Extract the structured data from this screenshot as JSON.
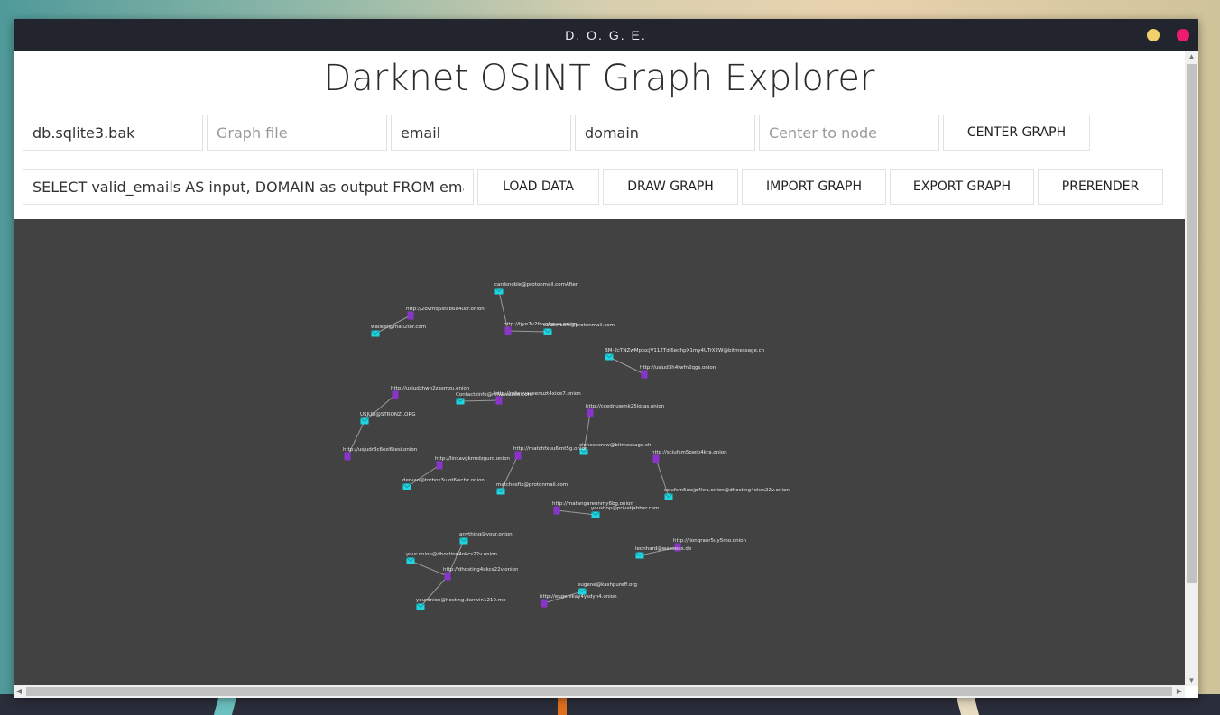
{
  "window": {
    "title": "D. O. G. E.",
    "controls": [
      "minimize",
      "close"
    ],
    "colors": {
      "titlebar": "#23252e",
      "minimize": "#f2d06b",
      "close": "#ef1b6f"
    }
  },
  "app": {
    "title": "Darknet OSINT Graph Explorer"
  },
  "toolbar_row1": {
    "db_file": {
      "value": "db.sqlite3.bak",
      "placeholder": ""
    },
    "graph_file": {
      "value": "",
      "placeholder": "Graph file"
    },
    "input_column": {
      "value": "email",
      "placeholder": ""
    },
    "output_column": {
      "value": "domain",
      "placeholder": ""
    },
    "center_node": {
      "value": "",
      "placeholder": "Center to node"
    },
    "center_graph_label": "CENTER GRAPH"
  },
  "toolbar_row2": {
    "query": {
      "value": "SELECT valid_emails AS input, DOMAIN as output FROM emails",
      "placeholder": ""
    },
    "load_data_label": "LOAD DATA",
    "draw_graph_label": "DRAW GRAPH",
    "import_graph_label": "IMPORT GRAPH",
    "export_graph_label": "EXPORT GRAPH",
    "prerender_label": "PRERENDER"
  },
  "graph": {
    "background": "#424242",
    "node_colors": {
      "email": "#1fd6e0",
      "domain": "#8a35c9"
    },
    "edge_color": "#9a9a9a",
    "nodes": [
      {
        "id": "n1",
        "type": "email",
        "label": "cardsnoble@protonmail.comAfter"
      },
      {
        "id": "n2",
        "type": "domain",
        "label": "http://tjye7v2fnxqfgsaa.onion"
      },
      {
        "id": "n3",
        "type": "email",
        "label": "cardsnoble@protonmail.com"
      },
      {
        "id": "n4",
        "type": "domain",
        "label": "http://2ovmq6sfab6u4ucr.onion"
      },
      {
        "id": "n5",
        "type": "email",
        "label": "wallker@mail2tor.com"
      },
      {
        "id": "n6",
        "type": "email",
        "label": "BM-2cTNZwMptscjV112Tdi6edhpX1my4UTrX2W@bitmessage.ch"
      },
      {
        "id": "n7",
        "type": "domain",
        "label": "http://usjud3h4fwfn2qgs.onion"
      },
      {
        "id": "n8",
        "type": "domain",
        "label": "http://usjudzhwh2zasmzu.onion"
      },
      {
        "id": "n9",
        "type": "email",
        "label": "USJUD@STRONZI.ORG"
      },
      {
        "id": "n10",
        "type": "domain",
        "label": "http://usjudr3c6ezi6tesi.onion"
      },
      {
        "id": "n11",
        "type": "email",
        "label": "Contactsinfo@mfwavazee.com"
      },
      {
        "id": "n12",
        "type": "domain",
        "label": "http://mfwavazeenuzt4xioe7.onion"
      },
      {
        "id": "n13",
        "type": "domain",
        "label": "http://ccednuwmk25iqtas.onion"
      },
      {
        "id": "n14",
        "type": "email",
        "label": "clonecccrew@bitmessage.ch"
      },
      {
        "id": "n15",
        "type": "domain",
        "label": "http://matchfxuu6znt5g.onion"
      },
      {
        "id": "n16",
        "type": "email",
        "label": "matchesfix@protonmail.com"
      },
      {
        "id": "n17",
        "type": "domain",
        "label": "http://linkavgkrmdzguro.onion"
      },
      {
        "id": "n18",
        "type": "email",
        "label": "dervan@torbox3uiot6wchz.onion"
      },
      {
        "id": "n19",
        "type": "domain",
        "label": "http://scjufsm5owjp4kra.onion"
      },
      {
        "id": "n20",
        "type": "email",
        "label": "scjufsm5owjp4kra.onion@dhosting4okcs22v.onion"
      },
      {
        "id": "n21",
        "type": "domain",
        "label": "http://matangareonmy6bg.onion"
      },
      {
        "id": "n22",
        "type": "email",
        "label": "youshop@privatjabber.com"
      },
      {
        "id": "n23",
        "type": "email",
        "label": "anything@your.onion"
      },
      {
        "id": "n24",
        "type": "email",
        "label": "your.onion@dhosting4okcs22v.onion"
      },
      {
        "id": "n25",
        "type": "domain",
        "label": "http://dhosting4okcs22v.onion"
      },
      {
        "id": "n26",
        "type": "email",
        "label": "youronion@hosting.danwin1210.me"
      },
      {
        "id": "n27",
        "type": "domain",
        "label": "http://lionqraer5uy5roo.onion"
      },
      {
        "id": "n28",
        "type": "email",
        "label": "leonhard@waeseus.de"
      },
      {
        "id": "n29",
        "type": "email",
        "label": "eugene@kashpureff.org"
      },
      {
        "id": "n30",
        "type": "domain",
        "label": "http://eugenikay4ysdyn4.onion"
      }
    ],
    "edges": [
      [
        "n1",
        "n2"
      ],
      [
        "n2",
        "n3"
      ],
      [
        "n4",
        "n5"
      ],
      [
        "n6",
        "n7"
      ],
      [
        "n8",
        "n9"
      ],
      [
        "n9",
        "n10"
      ],
      [
        "n11",
        "n12"
      ],
      [
        "n13",
        "n14"
      ],
      [
        "n15",
        "n16"
      ],
      [
        "n17",
        "n18"
      ],
      [
        "n19",
        "n20"
      ],
      [
        "n21",
        "n22"
      ],
      [
        "n23",
        "n25"
      ],
      [
        "n24",
        "n25"
      ],
      [
        "n25",
        "n26"
      ],
      [
        "n27",
        "n28"
      ],
      [
        "n29",
        "n30"
      ]
    ]
  }
}
